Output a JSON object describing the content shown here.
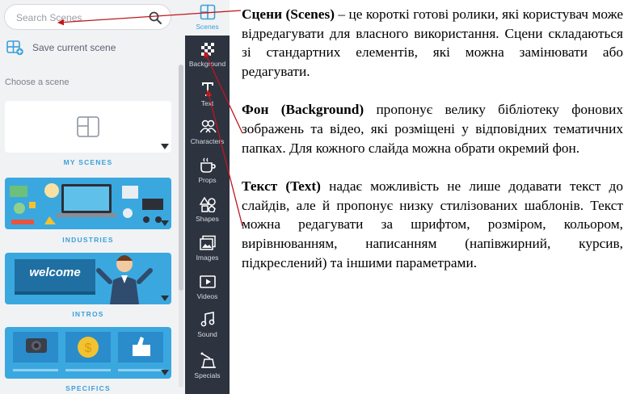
{
  "panel": {
    "search_placeholder": "Search Scenes",
    "save_label": "Save current scene",
    "choose_label": "Choose a scene",
    "cards": [
      {
        "label": "MY SCENES"
      },
      {
        "label": "INDUSTRIES"
      },
      {
        "label": "INTROS",
        "banner_text": "welcome"
      },
      {
        "label": "SPECIFICS"
      }
    ]
  },
  "toolbar": {
    "items": [
      {
        "label": "Scenes",
        "icon": "scenes-icon",
        "active": true
      },
      {
        "label": "Background",
        "icon": "background-icon"
      },
      {
        "label": "Text",
        "icon": "text-icon"
      },
      {
        "label": "Characters",
        "icon": "characters-icon"
      },
      {
        "label": "Props",
        "icon": "props-icon"
      },
      {
        "label": "Shapes",
        "icon": "shapes-icon"
      },
      {
        "label": "Images",
        "icon": "images-icon"
      },
      {
        "label": "Videos",
        "icon": "videos-icon"
      },
      {
        "label": "Sound",
        "icon": "sound-icon"
      },
      {
        "label": "Specials",
        "icon": "specials-icon"
      }
    ]
  },
  "description": {
    "p1_term": "Сцени (Scenes)",
    "p1_text": " – це короткі готові ролики, які користувач може відредагувати для власного використання. Сцени складаються зі стандартних елементів, які можна замінювати або редагувати.",
    "p2_term": "Фон (Background)",
    "p2_text": " пропонує велику бібліотеку фонових зображень та відео, які розміщені у відповідних тематичних папках. Для кожного слайда можна обрати окремий фон.",
    "p3_term": "Текст (Text)",
    "p3_text": " надає можливість не лише додавати текст до слайдів, але й пропонує низку стилізованих шаблонів. Текст можна редагувати за шрифтом, розміром, кольором, вирівнюванням, написанням (напівжирний, курсив, підкреслений) та іншими параметрами."
  },
  "colors": {
    "accent": "#3aa0d8",
    "toolbar_bg": "#2e3340",
    "panel_bg": "#f1f2f4",
    "arrow": "#c0161d"
  }
}
